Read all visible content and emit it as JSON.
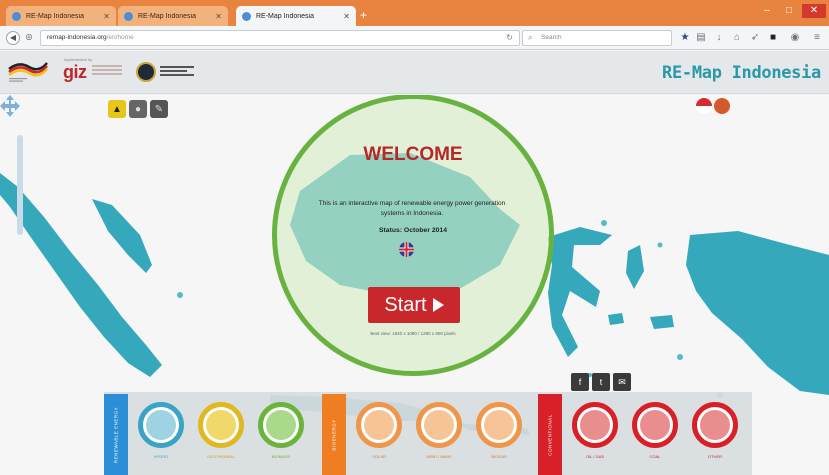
{
  "browser": {
    "tabs": [
      {
        "title": "RE-Map Indonesia",
        "active": false
      },
      {
        "title": "RE-Map Indonesia",
        "active": false
      },
      {
        "title": "RE-Map Indonesia",
        "active": true
      }
    ],
    "new_tab": "+",
    "url_host": "remap-indonesia.org",
    "url_path": "/en/home",
    "search_placeholder": "Search",
    "window_controls": {
      "minimize": "–",
      "maximize": "□",
      "close": "✕"
    },
    "toolbar_icons": [
      "star-icon",
      "clipboard-icon",
      "download-icon",
      "home-icon",
      "send-icon",
      "pocket-icon",
      "extension-icon",
      "menu-icon"
    ]
  },
  "header": {
    "implemented_by": "implemented by",
    "giz_logo": "giz",
    "site_title": "RE-Map Indonesia"
  },
  "map": {
    "layer_buttons": [
      "hazard-icon",
      "globe-icon",
      "tools-icon"
    ],
    "colors": {
      "sea": "#f5f6f5",
      "land": "#35a9bb",
      "land_light": "#58b9c8"
    }
  },
  "welcome": {
    "title": "WELCOME",
    "description": "This is an interactive map of renewable energy power generation systems in Indonesia.",
    "status": "Status: October 2014",
    "start_label": "Start",
    "hint": "Best view: 1920 x 1080 / 1280 x 800 pixels",
    "colors": {
      "ring": "#68b23f",
      "title": "#b52828",
      "button": "#c8272c"
    }
  },
  "social": [
    "facebook-icon",
    "twitter-icon",
    "mail-icon"
  ],
  "energy_bar": {
    "categories": [
      {
        "label": "RENEWABLE ENERGY",
        "color": "#2b8ed6"
      },
      {
        "label": "BIOENERGY",
        "color": "#ef7d22"
      },
      {
        "label": "CONVENTIONAL",
        "color": "#d72027"
      }
    ],
    "items": [
      {
        "label": "HYDRO",
        "color": "#3aa3c8",
        "icon": "water-drop-icon"
      },
      {
        "label": "GEOTHERMAL",
        "color": "#e0b820",
        "icon": "sun-icon"
      },
      {
        "label": "BIOMASS",
        "color": "#6bb43c",
        "icon": "leaf-icon"
      },
      {
        "label": "SOLAR",
        "color": "#f0964a",
        "icon": "solar-icon"
      },
      {
        "label": "WIND / WAVE",
        "color": "#f0964a",
        "icon": "wind-icon"
      },
      {
        "label": "BIOGAS",
        "color": "#f0964a",
        "icon": "biogas-icon"
      },
      {
        "label": "OIL / GAS",
        "color": "#d72027",
        "icon": "oil-icon"
      },
      {
        "label": "COAL",
        "color": "#d72027",
        "icon": "coal-icon"
      },
      {
        "label": "OTHER",
        "color": "#d72027",
        "icon": "other-icon"
      }
    ]
  }
}
